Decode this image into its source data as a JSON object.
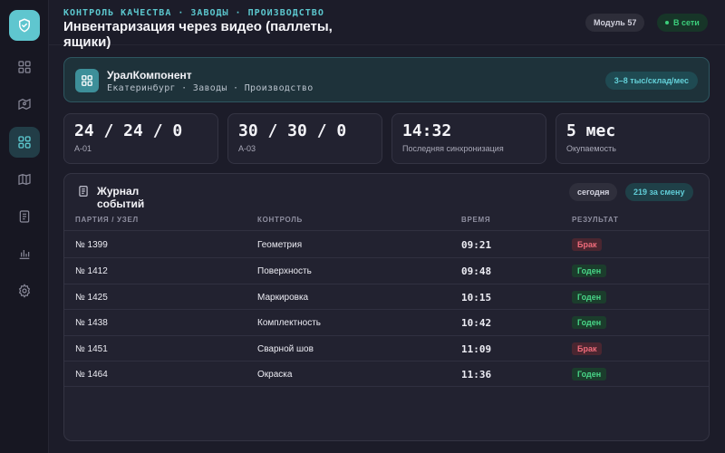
{
  "header": {
    "eyebrow": "КОНТРОЛЬ КАЧЕСТВА · ЗАВОДЫ · ПРОИЗВОДСТВО",
    "title": "Инвентаризация через видео (паллеты, ящики)",
    "module": "Модуль 57",
    "status": "В сети"
  },
  "sidebar": {
    "logo": "shield-check-icon",
    "items": [
      {
        "icon": "grid-icon",
        "active": false
      },
      {
        "icon": "map-pin-icon",
        "active": false
      },
      {
        "icon": "dashboard-icon",
        "active": true
      },
      {
        "icon": "map-icon",
        "active": false
      },
      {
        "icon": "document-icon",
        "active": false
      },
      {
        "icon": "bar-chart-icon",
        "active": false
      },
      {
        "icon": "gear-icon",
        "active": false
      }
    ]
  },
  "company": {
    "name": "УралКомпонент",
    "subtitle": "Екатеринбург · Заводы · Производство",
    "badge": "3–8 тыс/склад/мес"
  },
  "stats": [
    {
      "value": "24 / 24 / 0",
      "label": "A-01"
    },
    {
      "value": "30 / 30 / 0",
      "label": "A-03"
    },
    {
      "value": "14:32",
      "label": "Последняя синхронизация"
    },
    {
      "value": "5 мес",
      "label": "Окупаемость"
    }
  ],
  "events": {
    "title": "Журнал событий",
    "filter": "сегодня",
    "count": "219 за смену",
    "columns": [
      "ПАРТИЯ / УЗЕЛ",
      "КОНТРОЛЬ",
      "ВРЕМЯ",
      "РЕЗУЛЬТАТ"
    ],
    "rows": [
      {
        "batch": "№ 1399",
        "check": "Геометрия",
        "time": "09:21",
        "result": "Брак",
        "status": "bad"
      },
      {
        "batch": "№ 1412",
        "check": "Поверхность",
        "time": "09:48",
        "result": "Годен",
        "status": "good"
      },
      {
        "batch": "№ 1425",
        "check": "Маркировка",
        "time": "10:15",
        "result": "Годен",
        "status": "good"
      },
      {
        "batch": "№ 1438",
        "check": "Комплектность",
        "time": "10:42",
        "result": "Годен",
        "status": "good"
      },
      {
        "batch": "№ 1451",
        "check": "Сварной шов",
        "time": "11:09",
        "result": "Брак",
        "status": "bad"
      },
      {
        "batch": "№ 1464",
        "check": "Окраска",
        "time": "11:36",
        "result": "Годен",
        "status": "good"
      }
    ]
  },
  "colors": {
    "accent": "#5cc8cf",
    "good": "#48d587",
    "bad": "#ef6b7a",
    "background": "#1c1c29"
  }
}
